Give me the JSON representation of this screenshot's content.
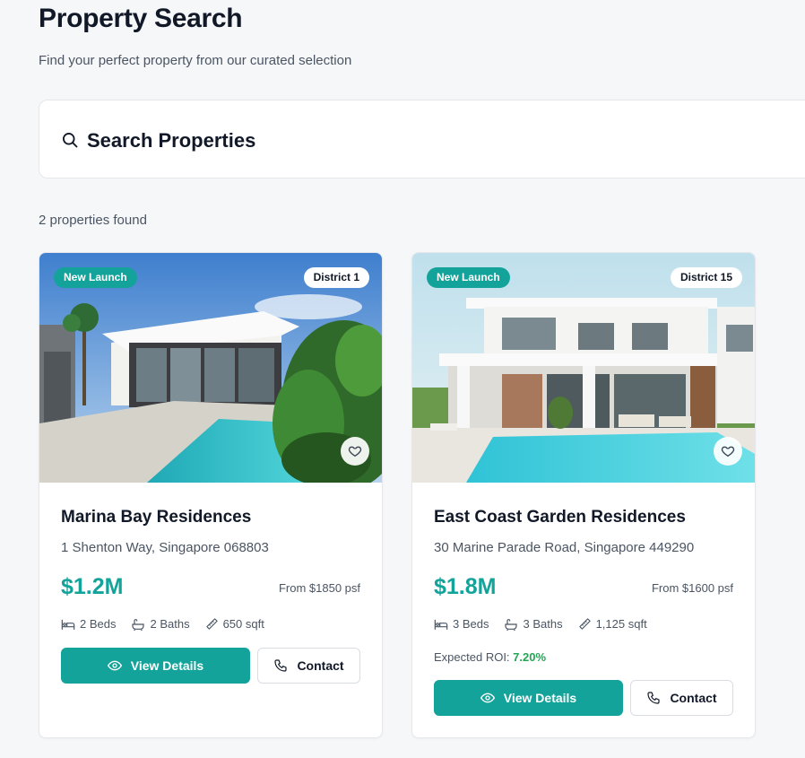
{
  "header": {
    "title": "Property Search",
    "subtitle": "Find your perfect property from our curated selection"
  },
  "search": {
    "title": "Search Properties",
    "icon": "search-icon"
  },
  "results": {
    "count_text": "2 properties found"
  },
  "properties": [
    {
      "badge": "New Launch",
      "district": "District 1",
      "name": "Marina Bay Residences",
      "address": "1 Shenton Way, Singapore 068803",
      "price": "$1.2M",
      "psf": "From $1850 psf",
      "beds": "2 Beds",
      "baths": "2 Baths",
      "area": "650 sqft",
      "view_label": "View Details",
      "contact_label": "Contact"
    },
    {
      "badge": "New Launch",
      "district": "District 15",
      "name": "East Coast Garden Residences",
      "address": "30 Marine Parade Road, Singapore 449290",
      "price": "$1.8M",
      "psf": "From $1600 psf",
      "beds": "3 Beds",
      "baths": "3 Baths",
      "area": "1,125 sqft",
      "roi_label": "Expected ROI:",
      "roi_value": "7.20%",
      "view_label": "View Details",
      "contact_label": "Contact"
    }
  ],
  "colors": {
    "accent": "#14a39a",
    "roi": "#22a654",
    "background": "#f6f7f9"
  }
}
